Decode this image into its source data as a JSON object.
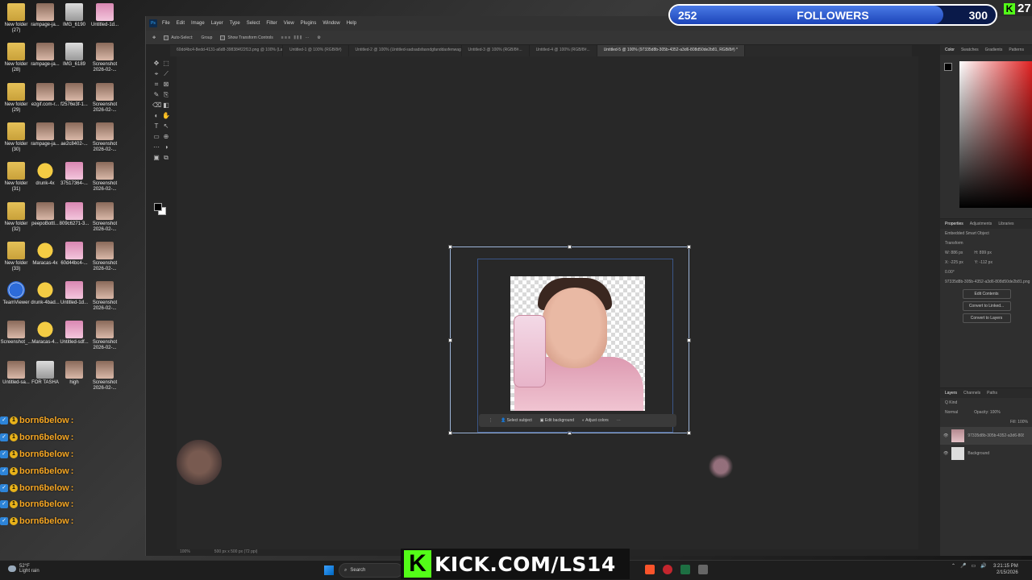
{
  "desktop": {
    "icons": [
      {
        "label": "New folder (27)",
        "kind": "folder"
      },
      {
        "label": "rampage-ja...",
        "kind": "photo"
      },
      {
        "label": "IMG_6190",
        "kind": "doc"
      },
      {
        "label": "Untitled-1d...",
        "kind": "pink"
      },
      {
        "label": "New folder (28)",
        "kind": "folder"
      },
      {
        "label": "rampage-ja...",
        "kind": "photo"
      },
      {
        "label": "IMG_6189",
        "kind": "doc"
      },
      {
        "label": "Screenshot 2026-02-...",
        "kind": "photo"
      },
      {
        "label": "New folder (29)",
        "kind": "folder"
      },
      {
        "label": "ezgif.com-r...",
        "kind": "photo"
      },
      {
        "label": "f2576e3f-1...",
        "kind": "photo"
      },
      {
        "label": "Screenshot 2026-02-...",
        "kind": "photo"
      },
      {
        "label": "New folder (30)",
        "kind": "folder"
      },
      {
        "label": "rampage-ja...",
        "kind": "photo"
      },
      {
        "label": "ae2c8402-...",
        "kind": "photo"
      },
      {
        "label": "Screenshot 2026-02-...",
        "kind": "photo"
      },
      {
        "label": "New folder (31)",
        "kind": "folder"
      },
      {
        "label": "drunk-4x",
        "kind": "emoji"
      },
      {
        "label": "37517364-...",
        "kind": "pink"
      },
      {
        "label": "Screenshot 2026-02-...",
        "kind": "photo"
      },
      {
        "label": "New folder (32)",
        "kind": "folder"
      },
      {
        "label": "peepoBottl...",
        "kind": "photo"
      },
      {
        "label": "809c6271-3...",
        "kind": "pink"
      },
      {
        "label": "Screenshot 2026-02-...",
        "kind": "photo"
      },
      {
        "label": "New folder (33)",
        "kind": "folder"
      },
      {
        "label": "Maracas-4x",
        "kind": "emoji"
      },
      {
        "label": "60d44bc4-...",
        "kind": "pink"
      },
      {
        "label": "Screenshot 2026-02-...",
        "kind": "photo"
      },
      {
        "label": "TeamViewer",
        "kind": "app"
      },
      {
        "label": "drunk-4bad...",
        "kind": "emoji"
      },
      {
        "label": "Untitled-1d...",
        "kind": "pink"
      },
      {
        "label": "Screenshot 2026-02-...",
        "kind": "photo"
      },
      {
        "label": "Screenshot_...",
        "kind": "photo"
      },
      {
        "label": "Maracas-4...",
        "kind": "emoji"
      },
      {
        "label": "Untitled-sdf...",
        "kind": "pink"
      },
      {
        "label": "Screenshot 2026-02-...",
        "kind": "photo"
      },
      {
        "label": "Untitled-sa...",
        "kind": "photo"
      },
      {
        "label": "FOR TASHA",
        "kind": "doc"
      },
      {
        "label": "high",
        "kind": "photo"
      },
      {
        "label": "Screenshot 2026-02-...",
        "kind": "photo"
      }
    ]
  },
  "photoshop": {
    "menu": [
      "File",
      "Edit",
      "Image",
      "Layer",
      "Type",
      "Select",
      "Filter",
      "View",
      "Plugins",
      "Window",
      "Help"
    ],
    "options": {
      "auto_select": "Auto-Select:",
      "group": "Group",
      "show_transform": "Show Transform Controls"
    },
    "tabs": [
      {
        "label": "60dd4bc4-8edd-4131-a6d8-398384f22f13.png @ 100% (Layer 1, RGB/...",
        "active": false
      },
      {
        "label": "Untitled-1 @ 100% (RGB/8#)",
        "active": false
      },
      {
        "label": "Untitled-2 @ 100% (Untitled-sadsadsfasndgfanddasfenwagd, RGB/8#...",
        "active": false
      },
      {
        "label": "Untitled-3 @ 100% (RGB/8#...",
        "active": false
      },
      {
        "label": "Untitled-4 @ 100% (RGB/8#...",
        "active": false
      },
      {
        "label": "Untitled-5 @ 100% (97335d8b-305b-4352-a3d6-808d50de2b81, RGB/8#) *",
        "active": true
      }
    ],
    "status": {
      "zoom": "100%",
      "size": "500 px x 500 px (72 ppi)"
    },
    "context_bar": {
      "select_subject": "Select subject",
      "edit_background": "Edit background",
      "adjust_colors": "Adjust colors"
    },
    "panels": {
      "color_tabs": [
        "Color",
        "Swatches",
        "Gradients",
        "Patterns"
      ],
      "props_tabs": [
        "Properties",
        "Adjustments",
        "Libraries"
      ],
      "embedded": "Embedded Smart Object",
      "transform": "Transform",
      "w": "W: 886 px",
      "h": "H: 899 px",
      "x": "X: -225 px",
      "y": "Y: -112 px",
      "angle": "0.00°",
      "filename": "97335d8b-305b-4352-a3d6-808d50de2b81.png",
      "buttons": [
        "Edit Contents",
        "Convert to Linked...",
        "Convert to Layers"
      ],
      "layers_tabs": [
        "Layers",
        "Channels",
        "Paths"
      ],
      "kind": "Q Kind",
      "blend": "Normal",
      "opacity": "Opacity: 100%",
      "fill": "Fill: 100%",
      "layers": [
        {
          "name": "97335d8b-305b-4352-a3d6-808d50de2b81",
          "selected": true
        },
        {
          "name": "Background",
          "selected": false
        }
      ]
    }
  },
  "overlay": {
    "followers_current": "252",
    "followers_label": "FOLLOWERS",
    "followers_goal": "300",
    "followers_progress": 0.84,
    "viewers": "27",
    "kick_url": "KICK.COM/LS14",
    "kick_logo_letter": "K"
  },
  "chat": {
    "name": "born6below",
    "lines": 7
  },
  "taskbar": {
    "temp": "52°F",
    "weather": "Light rain",
    "search": "Search",
    "time": "3:21:15 PM",
    "date": "2/15/2026"
  },
  "colors": {
    "kick_green": "#53fc18",
    "chat_name": "#f5a623",
    "ps_bg": "#282828"
  }
}
